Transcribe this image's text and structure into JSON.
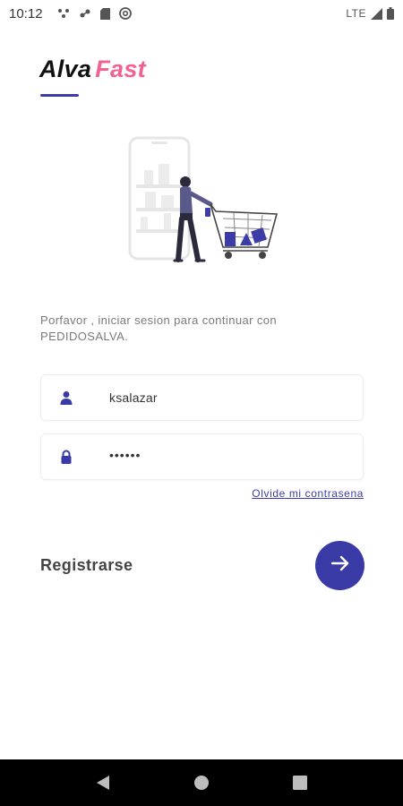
{
  "status_bar": {
    "time": "10:12",
    "network": "LTE"
  },
  "logo": {
    "part1": "Alva",
    "part2": "Fast"
  },
  "subtitle": "Porfavor , iniciar sesion para continuar con PEDIDOSALVA.",
  "form": {
    "username_value": "ksalazar",
    "password_value": "••••••",
    "forgot_label": "Olvide mi contrasena"
  },
  "register_label": "Registrarse",
  "colors": {
    "accent": "#3a3aa6",
    "brand_pink": "#f06292"
  },
  "icons": {
    "user": "user-icon",
    "lock": "lock-icon",
    "submit": "arrow-right-icon"
  }
}
